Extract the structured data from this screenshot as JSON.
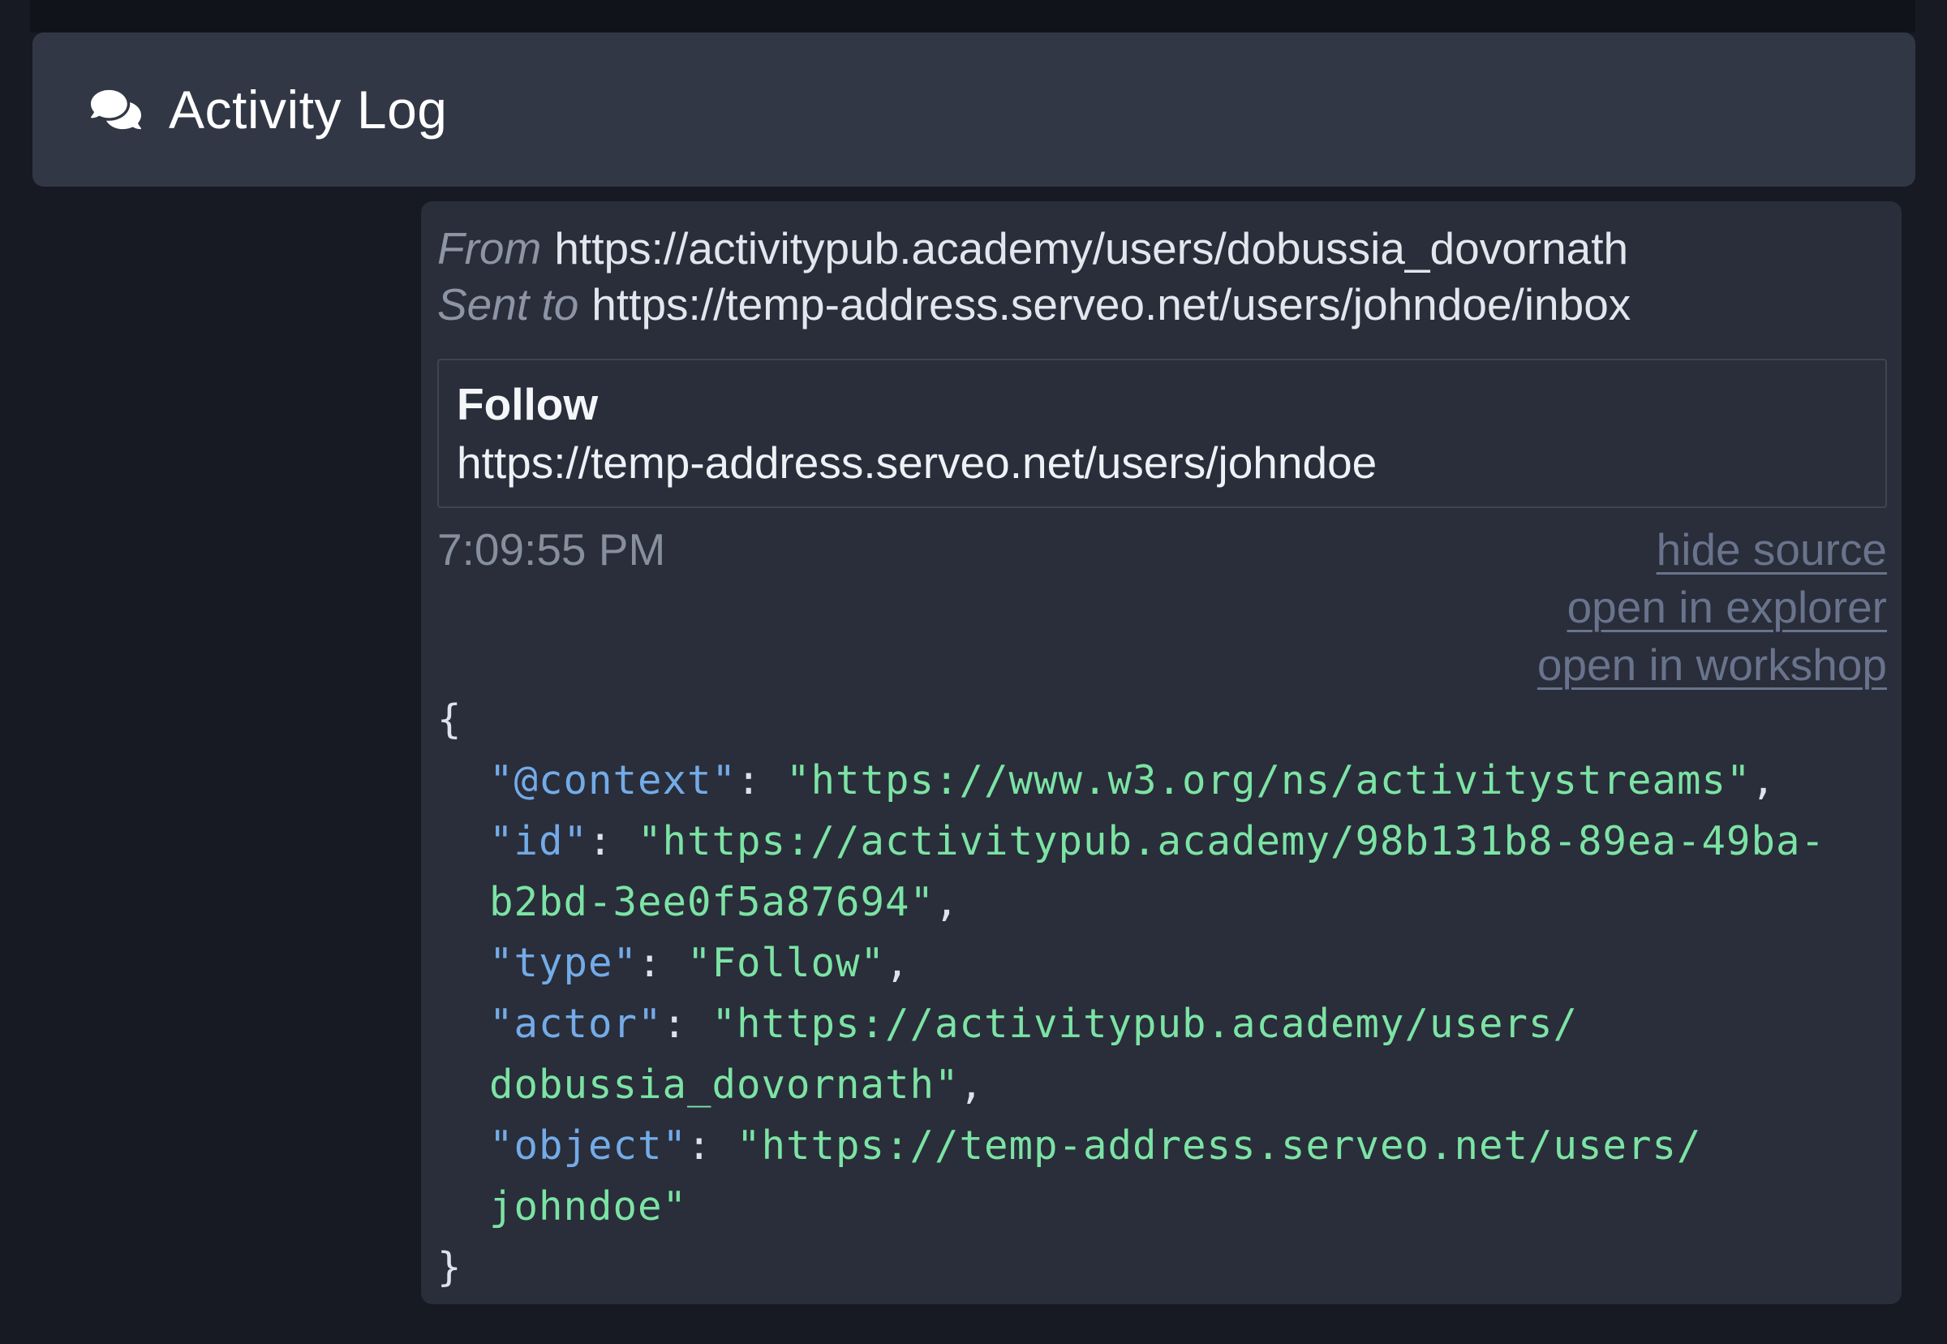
{
  "header": {
    "title": "Activity Log",
    "icon": "comments-icon"
  },
  "entry": {
    "from_label": "From",
    "from_url": "https://activitypub.academy/users/dobussia_dovornath",
    "sent_label": "Sent to",
    "sent_url": "https://temp-address.serveo.net/users/johndoe/inbox",
    "summary": {
      "type": "Follow",
      "target": "https://temp-address.serveo.net/users/johndoe"
    },
    "timestamp": "7:09:55 PM",
    "links": [
      {
        "label": "hide source",
        "name": "hide-source-link"
      },
      {
        "label": "open in explorer",
        "name": "open-in-explorer-link"
      },
      {
        "label": "open in workshop",
        "name": "open-in-workshop-link"
      }
    ],
    "code_lines": [
      {
        "indent": false,
        "tokens": [
          [
            "p",
            "{"
          ]
        ]
      },
      {
        "indent": true,
        "tokens": [
          [
            "k",
            "\"@context\""
          ],
          [
            "p",
            ": "
          ],
          [
            "s",
            "\"https://www.w3.org/ns/activitystreams\""
          ],
          [
            "p",
            ","
          ]
        ]
      },
      {
        "indent": true,
        "tokens": [
          [
            "k",
            "\"id\""
          ],
          [
            "p",
            ": "
          ],
          [
            "s",
            "\"https://activitypub.academy/98b131b8-89ea-49ba-"
          ]
        ]
      },
      {
        "indent": true,
        "tokens": [
          [
            "s",
            "b2bd-3ee0f5a87694\""
          ],
          [
            "p",
            ","
          ]
        ]
      },
      {
        "indent": true,
        "tokens": [
          [
            "k",
            "\"type\""
          ],
          [
            "p",
            ": "
          ],
          [
            "s",
            "\"Follow\""
          ],
          [
            "p",
            ","
          ]
        ]
      },
      {
        "indent": true,
        "tokens": [
          [
            "k",
            "\"actor\""
          ],
          [
            "p",
            ": "
          ],
          [
            "s",
            "\"https://activitypub.academy/users/"
          ]
        ]
      },
      {
        "indent": true,
        "tokens": [
          [
            "s",
            "dobussia_dovornath\""
          ],
          [
            "p",
            ","
          ]
        ]
      },
      {
        "indent": true,
        "tokens": [
          [
            "k",
            "\"object\""
          ],
          [
            "p",
            ": "
          ],
          [
            "s",
            "\"https://temp-address.serveo.net/users/"
          ]
        ]
      },
      {
        "indent": true,
        "tokens": [
          [
            "s",
            "johndoe\""
          ]
        ]
      },
      {
        "indent": false,
        "tokens": [
          [
            "p",
            "}"
          ]
        ]
      }
    ]
  },
  "colors": {
    "page_bg": "#171a23",
    "header_bg": "#323745",
    "card_bg": "#292e3a",
    "title_text": "#ffffff",
    "meta_label": "#8d95a5",
    "meta_url": "#e2e7ee",
    "box_border": "#3e4453",
    "timestamp": "#878f9e",
    "link": "#69738c",
    "code_key": "#74abe8",
    "code_string": "#7ce3a4",
    "code_punctuation": "#dde2ee"
  }
}
